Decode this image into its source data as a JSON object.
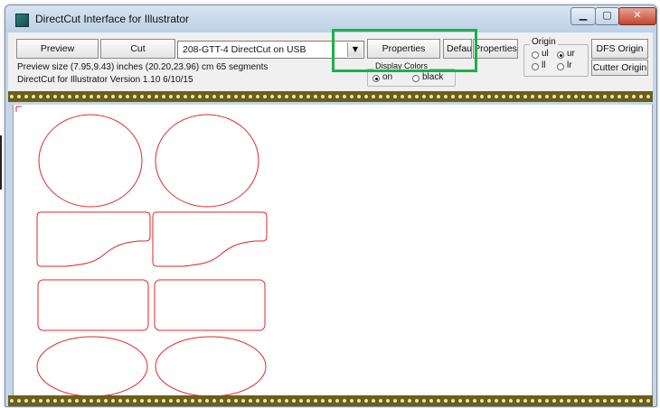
{
  "window": {
    "title": "DirectCut Interface for Illustrator",
    "icons": {
      "app": "directcut-app-icon",
      "minimize": "minimize-icon",
      "maximize": "maximize-icon",
      "close": "close-icon"
    }
  },
  "toolbar": {
    "preview_label": "Preview",
    "cut_label": "Cut",
    "device_select": {
      "value": "208-GTT-4 DirectCut on USB",
      "arrow_icon": "dropdown-arrow-icon"
    },
    "properties_label": "Properties",
    "default_label": "Defau",
    "properties2_label": "Properties",
    "dfs_origin_label": "DFS Origin",
    "cutter_origin_label": "Cutter Origin"
  },
  "info": {
    "preview_size": "Preview size (7.95,9.43) inches  (20.20,23.96) cm   65 segments",
    "version": "DirectCut for Illustrator Version 1.10 6/10/15"
  },
  "display_colors": {
    "label": "Display Colors",
    "options": [
      {
        "label": "on",
        "selected": true
      },
      {
        "label": "black",
        "selected": false
      }
    ]
  },
  "origin": {
    "label": "Origin",
    "options": [
      {
        "label": "ul",
        "selected": false
      },
      {
        "label": "ur",
        "selected": true
      },
      {
        "label": "ll",
        "selected": false
      },
      {
        "label": "lr",
        "selected": false
      }
    ]
  },
  "preview": {
    "shapes": [
      "oval",
      "oval",
      "tab-wave-rect",
      "tab-wave-rect",
      "rounded-rect",
      "rounded-rect",
      "oval",
      "oval"
    ],
    "shape_color": "#e0262b"
  },
  "colors": {
    "highlight": "#1db04a",
    "track": "#6b5f1a",
    "track_dots": "#e8e2a8"
  }
}
